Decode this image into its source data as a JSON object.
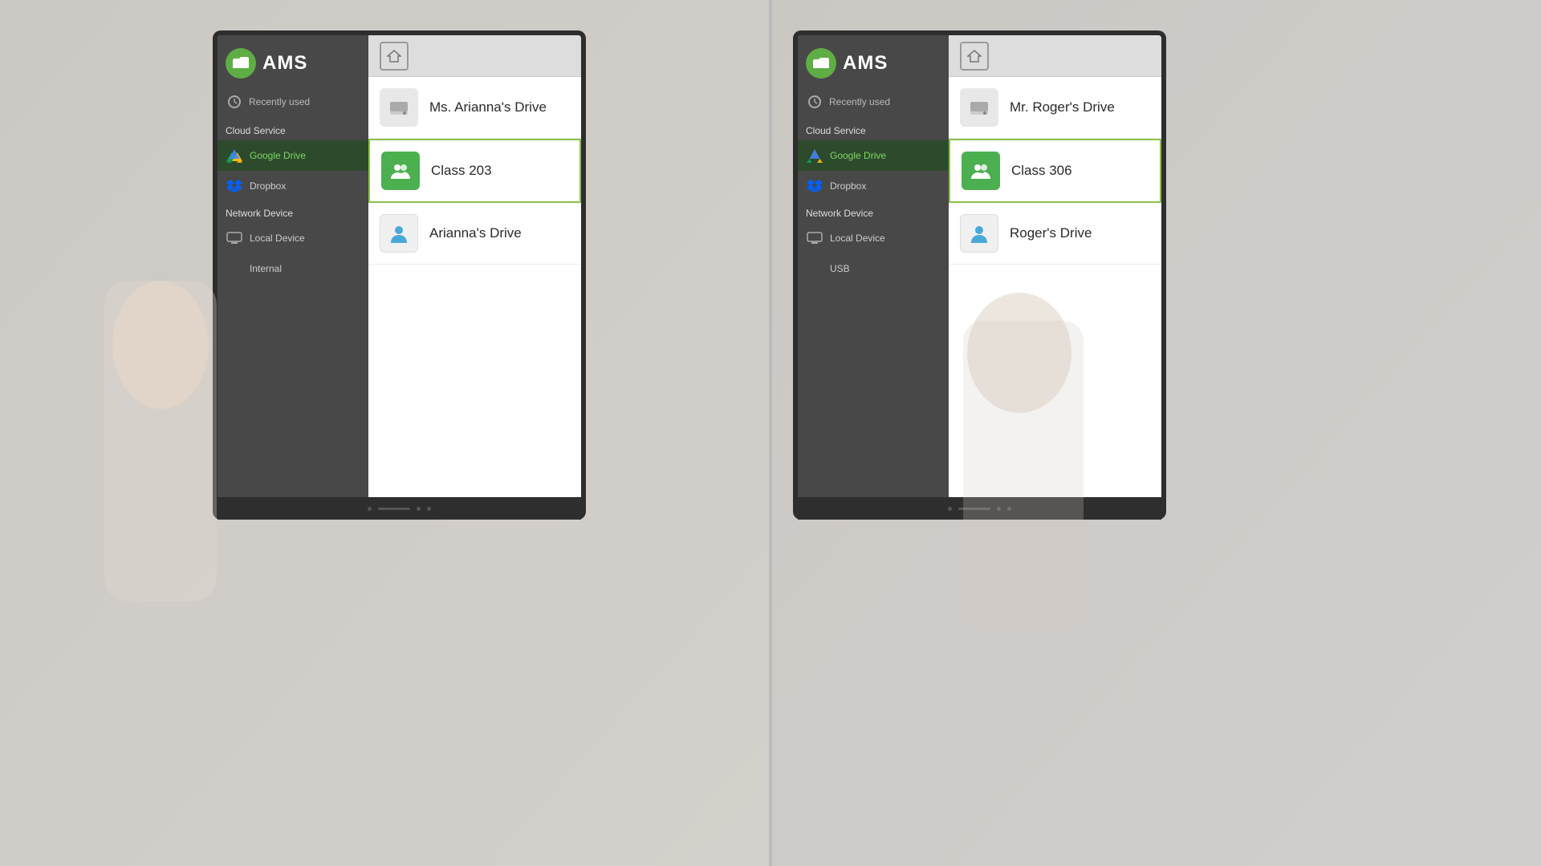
{
  "scene": {
    "background_color": "#ccc8c4",
    "background_color_right": "#c8c4c0"
  },
  "left_panel": {
    "monitor": {
      "title": "AMS",
      "sidebar": {
        "recently_used_label": "Recently used",
        "cloud_service_label": "Cloud Service",
        "google_drive_label": "Google Drive",
        "dropbox_label": "Dropbox",
        "network_device_label": "Network Device",
        "local_device_label": "Local Device",
        "internal_label": "Internal"
      },
      "content": {
        "items": [
          {
            "name": "Ms. Arianna's Drive",
            "type": "drive",
            "icon": "drive"
          },
          {
            "name": "Class 203",
            "type": "class",
            "icon": "people"
          },
          {
            "name": "Arianna's Drive",
            "type": "personal",
            "icon": "person"
          }
        ]
      }
    }
  },
  "right_panel": {
    "monitor": {
      "title": "AMS",
      "sidebar": {
        "recently_used_label": "Recently used",
        "cloud_service_label": "Cloud Service",
        "google_drive_label": "Google Drive",
        "dropbox_label": "Dropbox",
        "network_device_label": "Network Device",
        "local_device_label": "Local Device",
        "usb_label": "USB"
      },
      "content": {
        "items": [
          {
            "name": "Mr. Roger's Drive",
            "type": "drive",
            "icon": "drive"
          },
          {
            "name": "Class 306",
            "type": "class",
            "icon": "people"
          },
          {
            "name": "Roger's Drive",
            "type": "personal",
            "icon": "person"
          }
        ]
      }
    }
  },
  "icons": {
    "folder": "📁",
    "home": "⌂",
    "clock": "🕐",
    "drive": "△",
    "people": "👥",
    "person": "👤"
  }
}
